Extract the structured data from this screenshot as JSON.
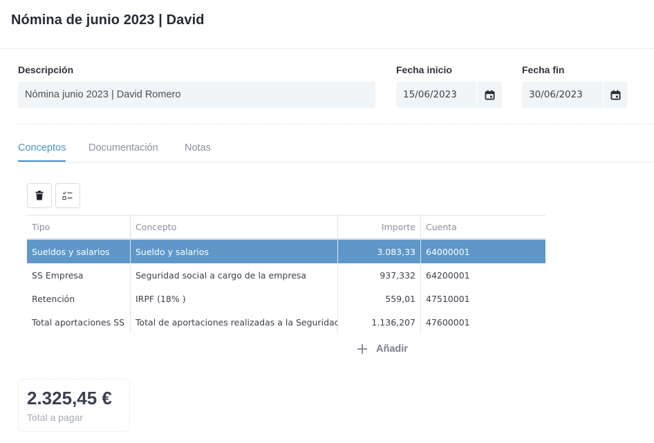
{
  "page": {
    "title": "Nómina de junio 2023 | David"
  },
  "form": {
    "description_label": "Descripción",
    "description_value": "Nómina junio 2023 | David Romero",
    "start_label": "Fecha inicio",
    "start_value": "15/06/2023",
    "end_label": "Fecha fin",
    "end_value": "30/06/2023"
  },
  "tabs": [
    {
      "label": "Conceptos",
      "active": true
    },
    {
      "label": "Documentación",
      "active": false
    },
    {
      "label": "Notas",
      "active": false
    }
  ],
  "toolbar": {
    "delete_icon": "trash-icon",
    "select_icon": "checklist-icon"
  },
  "grid": {
    "columns": [
      "Tipo",
      "Concepto",
      "Importe",
      "Cuenta"
    ],
    "rows": [
      {
        "tipo": "Sueldos y salarios",
        "concepto": "Sueldo y salarios",
        "importe": "3.083,33",
        "cuenta": "64000001",
        "selected": true
      },
      {
        "tipo": "SS Empresa",
        "concepto": "Seguridad social a cargo de la empresa",
        "importe": "937,332",
        "cuenta": "64200001",
        "selected": false
      },
      {
        "tipo": "Retención",
        "concepto": "IRPF (18% )",
        "importe": "559,01",
        "cuenta": "47510001",
        "selected": false
      },
      {
        "tipo": "Total aportaciones SS",
        "concepto": "Total de aportaciones realizadas a la Seguridad Social",
        "importe": "1.136,207",
        "cuenta": "47600001",
        "selected": false
      }
    ],
    "add_label": "Añadir"
  },
  "summary": {
    "amount": "2.325,45 €",
    "label": "Total a pagar"
  },
  "colors": {
    "accent": "#4a8fc6",
    "selected_row": "#5e97c8"
  }
}
